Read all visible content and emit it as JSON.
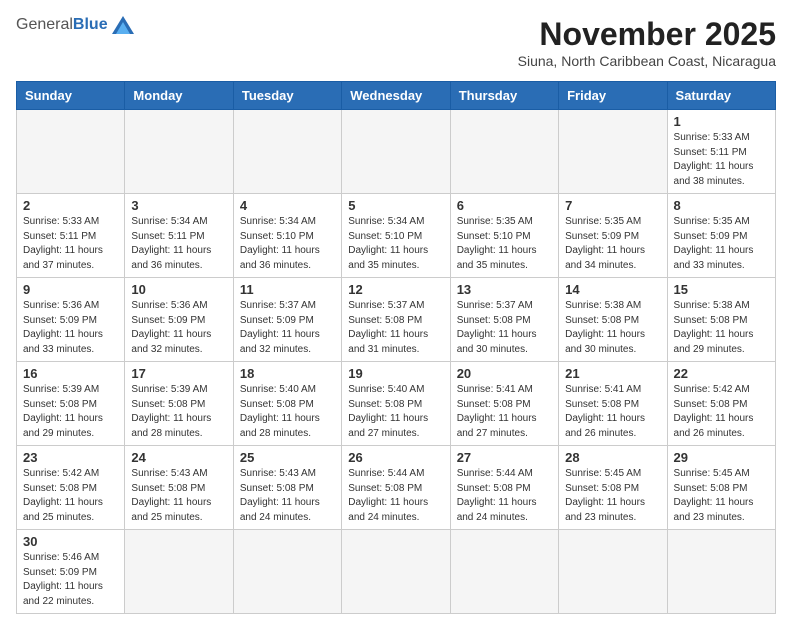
{
  "header": {
    "logo": {
      "general": "General",
      "blue": "Blue"
    },
    "title": "November 2025",
    "subtitle": "Siuna, North Caribbean Coast, Nicaragua"
  },
  "days_of_week": [
    "Sunday",
    "Monday",
    "Tuesday",
    "Wednesday",
    "Thursday",
    "Friday",
    "Saturday"
  ],
  "weeks": [
    [
      {
        "day": "",
        "info": ""
      },
      {
        "day": "",
        "info": ""
      },
      {
        "day": "",
        "info": ""
      },
      {
        "day": "",
        "info": ""
      },
      {
        "day": "",
        "info": ""
      },
      {
        "day": "",
        "info": ""
      },
      {
        "day": "1",
        "info": "Sunrise: 5:33 AM\nSunset: 5:11 PM\nDaylight: 11 hours\nand 38 minutes."
      }
    ],
    [
      {
        "day": "2",
        "info": "Sunrise: 5:33 AM\nSunset: 5:11 PM\nDaylight: 11 hours\nand 37 minutes."
      },
      {
        "day": "3",
        "info": "Sunrise: 5:34 AM\nSunset: 5:11 PM\nDaylight: 11 hours\nand 36 minutes."
      },
      {
        "day": "4",
        "info": "Sunrise: 5:34 AM\nSunset: 5:10 PM\nDaylight: 11 hours\nand 36 minutes."
      },
      {
        "day": "5",
        "info": "Sunrise: 5:34 AM\nSunset: 5:10 PM\nDaylight: 11 hours\nand 35 minutes."
      },
      {
        "day": "6",
        "info": "Sunrise: 5:35 AM\nSunset: 5:10 PM\nDaylight: 11 hours\nand 35 minutes."
      },
      {
        "day": "7",
        "info": "Sunrise: 5:35 AM\nSunset: 5:09 PM\nDaylight: 11 hours\nand 34 minutes."
      },
      {
        "day": "8",
        "info": "Sunrise: 5:35 AM\nSunset: 5:09 PM\nDaylight: 11 hours\nand 33 minutes."
      }
    ],
    [
      {
        "day": "9",
        "info": "Sunrise: 5:36 AM\nSunset: 5:09 PM\nDaylight: 11 hours\nand 33 minutes."
      },
      {
        "day": "10",
        "info": "Sunrise: 5:36 AM\nSunset: 5:09 PM\nDaylight: 11 hours\nand 32 minutes."
      },
      {
        "day": "11",
        "info": "Sunrise: 5:37 AM\nSunset: 5:09 PM\nDaylight: 11 hours\nand 32 minutes."
      },
      {
        "day": "12",
        "info": "Sunrise: 5:37 AM\nSunset: 5:08 PM\nDaylight: 11 hours\nand 31 minutes."
      },
      {
        "day": "13",
        "info": "Sunrise: 5:37 AM\nSunset: 5:08 PM\nDaylight: 11 hours\nand 30 minutes."
      },
      {
        "day": "14",
        "info": "Sunrise: 5:38 AM\nSunset: 5:08 PM\nDaylight: 11 hours\nand 30 minutes."
      },
      {
        "day": "15",
        "info": "Sunrise: 5:38 AM\nSunset: 5:08 PM\nDaylight: 11 hours\nand 29 minutes."
      }
    ],
    [
      {
        "day": "16",
        "info": "Sunrise: 5:39 AM\nSunset: 5:08 PM\nDaylight: 11 hours\nand 29 minutes."
      },
      {
        "day": "17",
        "info": "Sunrise: 5:39 AM\nSunset: 5:08 PM\nDaylight: 11 hours\nand 28 minutes."
      },
      {
        "day": "18",
        "info": "Sunrise: 5:40 AM\nSunset: 5:08 PM\nDaylight: 11 hours\nand 28 minutes."
      },
      {
        "day": "19",
        "info": "Sunrise: 5:40 AM\nSunset: 5:08 PM\nDaylight: 11 hours\nand 27 minutes."
      },
      {
        "day": "20",
        "info": "Sunrise: 5:41 AM\nSunset: 5:08 PM\nDaylight: 11 hours\nand 27 minutes."
      },
      {
        "day": "21",
        "info": "Sunrise: 5:41 AM\nSunset: 5:08 PM\nDaylight: 11 hours\nand 26 minutes."
      },
      {
        "day": "22",
        "info": "Sunrise: 5:42 AM\nSunset: 5:08 PM\nDaylight: 11 hours\nand 26 minutes."
      }
    ],
    [
      {
        "day": "23",
        "info": "Sunrise: 5:42 AM\nSunset: 5:08 PM\nDaylight: 11 hours\nand 25 minutes."
      },
      {
        "day": "24",
        "info": "Sunrise: 5:43 AM\nSunset: 5:08 PM\nDaylight: 11 hours\nand 25 minutes."
      },
      {
        "day": "25",
        "info": "Sunrise: 5:43 AM\nSunset: 5:08 PM\nDaylight: 11 hours\nand 24 minutes."
      },
      {
        "day": "26",
        "info": "Sunrise: 5:44 AM\nSunset: 5:08 PM\nDaylight: 11 hours\nand 24 minutes."
      },
      {
        "day": "27",
        "info": "Sunrise: 5:44 AM\nSunset: 5:08 PM\nDaylight: 11 hours\nand 24 minutes."
      },
      {
        "day": "28",
        "info": "Sunrise: 5:45 AM\nSunset: 5:08 PM\nDaylight: 11 hours\nand 23 minutes."
      },
      {
        "day": "29",
        "info": "Sunrise: 5:45 AM\nSunset: 5:08 PM\nDaylight: 11 hours\nand 23 minutes."
      }
    ],
    [
      {
        "day": "30",
        "info": "Sunrise: 5:46 AM\nSunset: 5:09 PM\nDaylight: 11 hours\nand 22 minutes."
      },
      {
        "day": "",
        "info": ""
      },
      {
        "day": "",
        "info": ""
      },
      {
        "day": "",
        "info": ""
      },
      {
        "day": "",
        "info": ""
      },
      {
        "day": "",
        "info": ""
      },
      {
        "day": "",
        "info": ""
      }
    ]
  ]
}
